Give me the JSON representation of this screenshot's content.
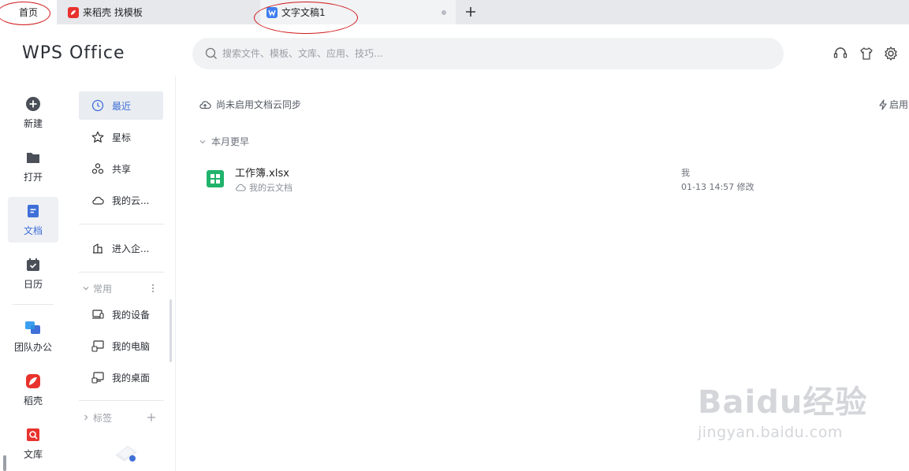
{
  "tabs": [
    {
      "label": "首页"
    },
    {
      "label": "来稻壳 找模板"
    },
    {
      "label": "文字文稿1"
    }
  ],
  "header": {
    "logo": "WPS Office",
    "search_placeholder": "搜索文件、模板、文库、应用、技巧..."
  },
  "left_nav": {
    "items": [
      {
        "label": "新建",
        "icon": "plus-circle-icon"
      },
      {
        "label": "打开",
        "icon": "folder-icon"
      },
      {
        "label": "文档",
        "icon": "document-icon",
        "active": true
      },
      {
        "label": "日历",
        "icon": "calendar-icon"
      },
      {
        "label": "团队办公",
        "icon": "team-icon"
      },
      {
        "label": "稻壳",
        "icon": "daoke-icon"
      },
      {
        "label": "文库",
        "icon": "library-icon"
      }
    ]
  },
  "second_nav": {
    "items": [
      {
        "label": "最近",
        "icon": "clock-icon",
        "active": true
      },
      {
        "label": "星标",
        "icon": "star-icon"
      },
      {
        "label": "共享",
        "icon": "share-icon"
      },
      {
        "label": "我的云...",
        "icon": "cloud-icon"
      }
    ],
    "enterprise": {
      "label": "进入企...",
      "icon": "building-icon"
    },
    "common_section": {
      "title": "常用"
    },
    "common_items": [
      {
        "label": "我的设备",
        "icon": "device-icon"
      },
      {
        "label": "我的电脑",
        "icon": "computer-icon"
      },
      {
        "label": "我的桌面",
        "icon": "desktop-icon"
      }
    ],
    "tags_section": {
      "title": "标签"
    }
  },
  "main": {
    "cloud_sync_text": "尚未启用文档云同步",
    "enable_text": "启用",
    "group_header": "本月更早",
    "files": [
      {
        "name": "工作簿.xlsx",
        "location": "我的云文档",
        "owner": "我",
        "modified": "01-13 14:57 修改"
      }
    ]
  },
  "watermark": {
    "main": "Baidu经验",
    "sub": "jingyan.baidu.com"
  },
  "colors": {
    "accent": "#3f6fd8",
    "annotation_red": "#d0191b",
    "xlsx_green": "#20b36b",
    "wps_red": "#e8322d"
  }
}
